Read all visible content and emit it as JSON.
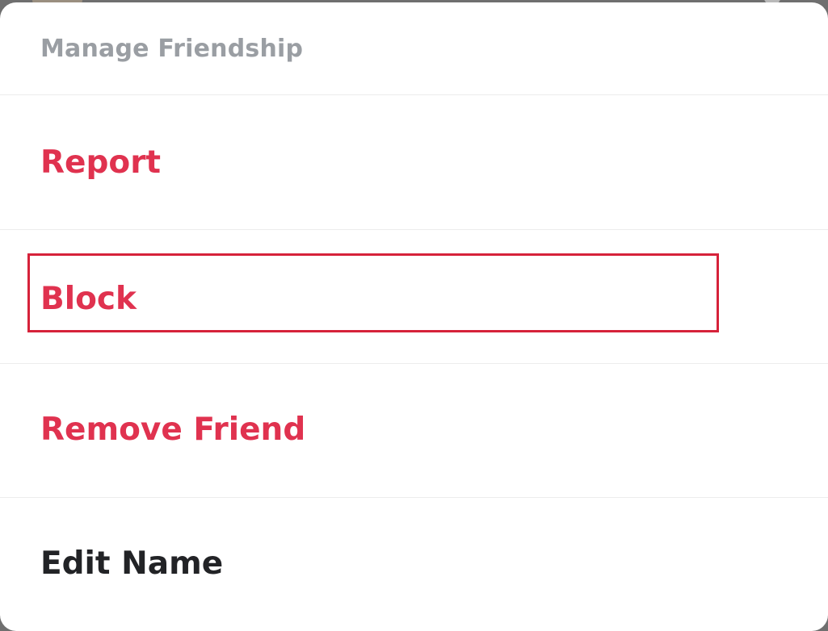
{
  "colors": {
    "danger_text": "#e0324f",
    "normal_text": "#222326",
    "header_text": "#9a9ea3",
    "highlight_border": "#d6223a"
  },
  "sheet": {
    "title": "Manage Friendship",
    "items": [
      {
        "label": "Report",
        "style": "danger"
      },
      {
        "label": "Block",
        "style": "danger",
        "highlighted": true
      },
      {
        "label": "Remove Friend",
        "style": "danger"
      },
      {
        "label": "Edit Name",
        "style": "normal"
      }
    ]
  }
}
